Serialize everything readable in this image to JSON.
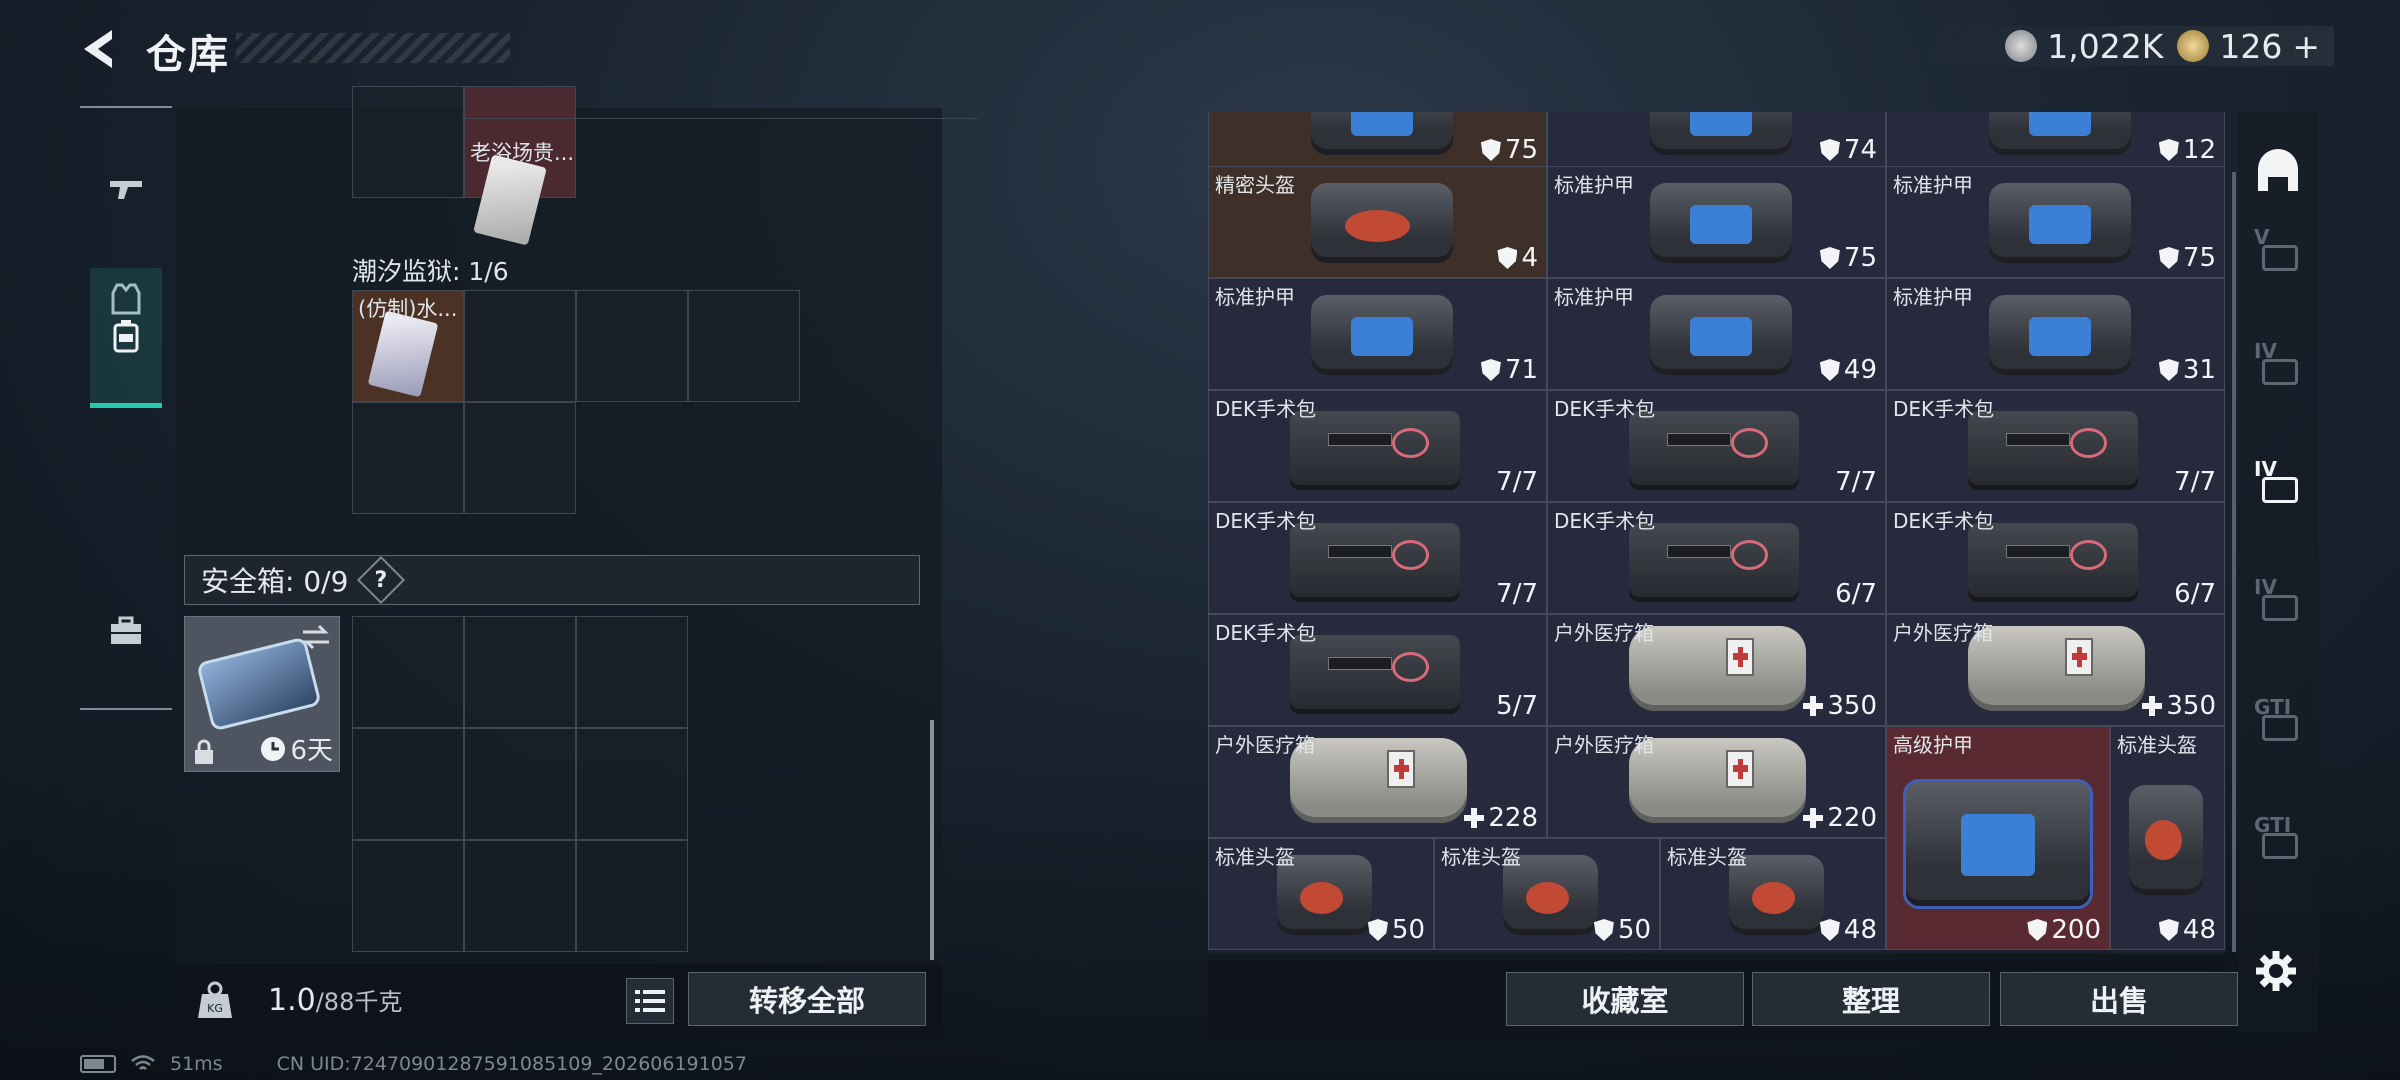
{
  "header": {
    "title": "仓库"
  },
  "currency": [
    {
      "icon": "silver-coin-icon",
      "value": "1,022K"
    },
    {
      "icon": "gold-coin-icon",
      "value": "126",
      "add": "+"
    }
  ],
  "left_nav": [
    "gun-icon",
    "armor-vest-icon",
    "backpack-icon",
    "toolbox-icon"
  ],
  "left_panel": {
    "top_item": {
      "name": "老浴场贵..."
    },
    "collection_label": "潮汐监狱: 1/6",
    "collection_item": {
      "name": "(仿制)水..."
    },
    "safe_box": {
      "label": "安全箱: 0/9",
      "help": "?",
      "timer": "6天"
    },
    "weight": {
      "value": "1.0",
      "max": "/88千克"
    },
    "transfer_all": "转移全部"
  },
  "right_panel": {
    "top_partial": [
      "75",
      "74",
      "12"
    ],
    "rows": [
      [
        {
          "name": "精密头盔",
          "val": "4",
          "kind": "shield",
          "img": "helmet-bag",
          "bg": "brown"
        },
        {
          "name": "标准护甲",
          "val": "75",
          "kind": "shield",
          "img": "armor-bag"
        },
        {
          "name": "标准护甲",
          "val": "75",
          "kind": "shield",
          "img": "armor-bag"
        }
      ],
      [
        {
          "name": "标准护甲",
          "val": "71",
          "kind": "shield",
          "img": "armor-bag"
        },
        {
          "name": "标准护甲",
          "val": "49",
          "kind": "shield",
          "img": "armor-bag"
        },
        {
          "name": "标准护甲",
          "val": "31",
          "kind": "shield",
          "img": "armor-bag"
        }
      ],
      [
        {
          "name": "DEK手术包",
          "val": "7/7",
          "kind": "count",
          "img": "kit"
        },
        {
          "name": "DEK手术包",
          "val": "7/7",
          "kind": "count",
          "img": "kit"
        },
        {
          "name": "DEK手术包",
          "val": "7/7",
          "kind": "count",
          "img": "kit"
        }
      ],
      [
        {
          "name": "DEK手术包",
          "val": "7/7",
          "kind": "count",
          "img": "kit"
        },
        {
          "name": "DEK手术包",
          "val": "6/7",
          "kind": "count",
          "img": "kit"
        },
        {
          "name": "DEK手术包",
          "val": "6/7",
          "kind": "count",
          "img": "kit"
        }
      ],
      [
        {
          "name": "DEK手术包",
          "val": "5/7",
          "kind": "count",
          "img": "kit"
        },
        {
          "name": "户外医疗箱",
          "val": "350",
          "kind": "plus",
          "img": "med"
        },
        {
          "name": "户外医疗箱",
          "val": "350",
          "kind": "plus",
          "img": "med"
        }
      ],
      [
        {
          "name": "户外医疗箱",
          "val": "228",
          "kind": "plus",
          "img": "med"
        },
        {
          "name": "户外医疗箱",
          "val": "220",
          "kind": "plus",
          "img": "med"
        }
      ]
    ],
    "bottom_helmets": [
      {
        "name": "标准头盔",
        "val": "50"
      },
      {
        "name": "标准头盔",
        "val": "50"
      },
      {
        "name": "标准头盔",
        "val": "48"
      }
    ],
    "big_armor": {
      "name": "高级护甲",
      "val": "200"
    },
    "tall_helmet": {
      "name": "标准头盔",
      "val": "48"
    },
    "buttons": [
      "收藏室",
      "整理",
      "出售"
    ]
  },
  "right_nav": [
    {
      "icon": "helmet-icon",
      "label": ""
    },
    {
      "icon": "level-5-armor-icon",
      "label": "V"
    },
    {
      "icon": "level-4-armor-icon",
      "label": "IV"
    },
    {
      "icon": "level-4-medkit-icon",
      "label": "IV"
    },
    {
      "icon": "level-4-medkit-add-icon",
      "label": "IV"
    },
    {
      "icon": "gti-kit-icon",
      "label": "GTI"
    },
    {
      "icon": "gti-bag-icon",
      "label": "GTI"
    },
    {
      "icon": "settings-gear-icon",
      "label": ""
    }
  ],
  "status": {
    "ping": "51ms",
    "uid": "CN UID:7247090128759108510​9_202606191057"
  }
}
